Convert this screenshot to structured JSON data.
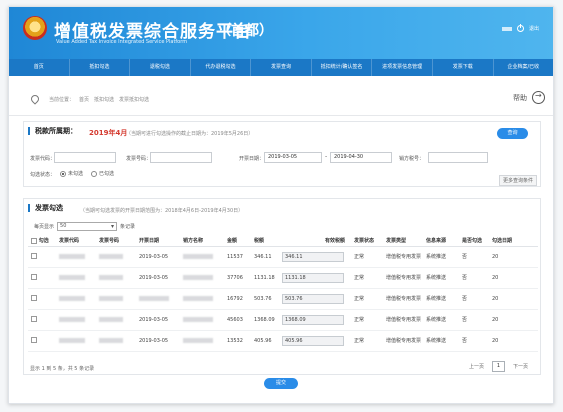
{
  "header": {
    "title": "增值税发票综合服务平台",
    "region": "（首都）",
    "subtitle_en": "Value Added Tax Invoice Integrated Service Platform",
    "logout_label": "退出"
  },
  "nav": {
    "items": [
      "首页",
      "抵扣勾选",
      "退税勾选",
      "代办退税勾选",
      "发票查询",
      "抵扣统计/确认签名",
      "进项发票信息管理",
      "发票下载",
      "企业档案/已收"
    ]
  },
  "breadcrumb": {
    "items": [
      "当前位置：",
      "首页",
      "抵扣勾选",
      "发票抵扣勾选"
    ],
    "help_label": "帮助"
  },
  "query_panel": {
    "title": "税款所属期：",
    "period": "2019年4月",
    "note": "（当期可进行勾选操作的截止日期为：2019年5月26日）",
    "query_button": "查询",
    "fields": {
      "invoice_code_label": "发票代码：",
      "invoice_number_label": "发票号码：",
      "issue_date_label": "开票日期：",
      "date_from": "2019-03-05",
      "date_sep": "-",
      "date_to": "2019-04-30",
      "seller_tax_label": "销方税号：",
      "status_label": "勾选状态：",
      "radio_unchecked": "未勾选",
      "radio_checked": "已勾选"
    },
    "more_conditions": "更多查询条件"
  },
  "list_panel": {
    "title": "发票勾选",
    "note": "（当期可勾选发票的开票日期范围为：2018年4月6日-2019年4月30日）",
    "pagesize_label": "每页显示",
    "pagesize_value": "50",
    "pagesize_unit": "条记录",
    "columns": [
      "勾选",
      "发票代码",
      "发票号码",
      "开票日期",
      "销方名称",
      "金额",
      "税额",
      "有效税额",
      "发票状态",
      "发票类型",
      "信息来源",
      "是否勾选",
      "勾选日期"
    ],
    "rows": [
      {
        "date": "2019-03-05",
        "amount": "11537",
        "tax": "346.11",
        "eff": "346.11",
        "status": "正常",
        "type": "增值税专用发票",
        "source": "系统推送",
        "checked": "否",
        "extra": "20"
      },
      {
        "date": "2019-03-05",
        "amount": "37706",
        "tax": "1131.18",
        "eff": "1131.18",
        "status": "正常",
        "type": "增值税专用发票",
        "source": "系统推送",
        "checked": "否",
        "extra": "20"
      },
      {
        "date": "",
        "amount": "16792",
        "tax": "503.76",
        "eff": "503.76",
        "status": "正常",
        "type": "增值税专用发票",
        "source": "系统推送",
        "checked": "否",
        "extra": "20"
      },
      {
        "date": "2019-03-05",
        "amount": "45603",
        "tax": "1368.09",
        "eff": "1368.09",
        "status": "正常",
        "type": "增值税专用发票",
        "source": "系统推送",
        "checked": "否",
        "extra": "20"
      },
      {
        "date": "2019-03-05",
        "amount": "13532",
        "tax": "405.96",
        "eff": "405.96",
        "status": "正常",
        "type": "增值税专用发票",
        "source": "系统推送",
        "checked": "否",
        "extra": "20"
      }
    ],
    "pager_info": "显示 1 到 5 条，共 5 条记录",
    "prev_label": "上一页",
    "current_page": "1",
    "next_label": "下一页"
  },
  "submit_button": "提交",
  "colors": {
    "header_blue": "#1f87d6",
    "nav_blue": "#1b78c6",
    "button_blue": "#2a8ce8",
    "period_red": "#d43a2f"
  }
}
